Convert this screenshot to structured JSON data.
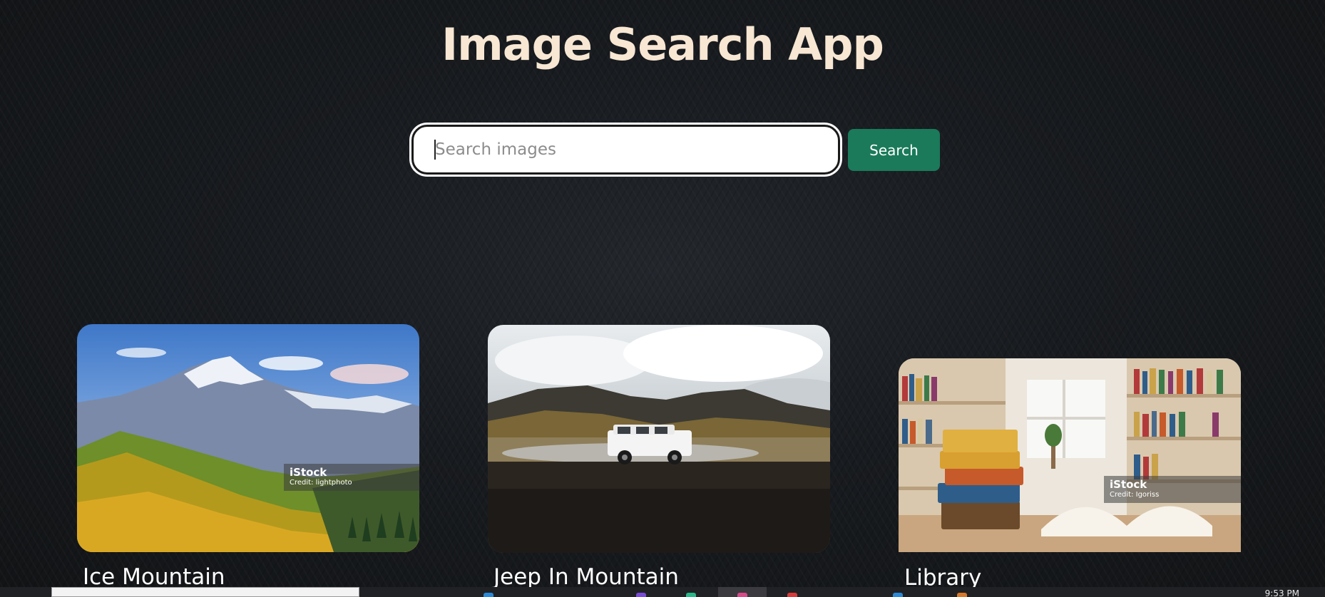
{
  "app": {
    "title": "Image Search App"
  },
  "search": {
    "placeholder": "Search images",
    "button_label": "Search"
  },
  "results": [
    {
      "title": "Ice Mountain",
      "watermark_brand": "iStock",
      "watermark_credit": "Credit: lightphoto"
    },
    {
      "title": "Jeep In Mountain"
    },
    {
      "title": "Library",
      "watermark_brand": "iStock",
      "watermark_credit": "Credit: Igoriss"
    }
  ],
  "taskbar": {
    "clock": "9:53 PM"
  },
  "colors": {
    "accent": "#1a7a5a",
    "title": "#f7e7d3",
    "background": "#15181b"
  }
}
